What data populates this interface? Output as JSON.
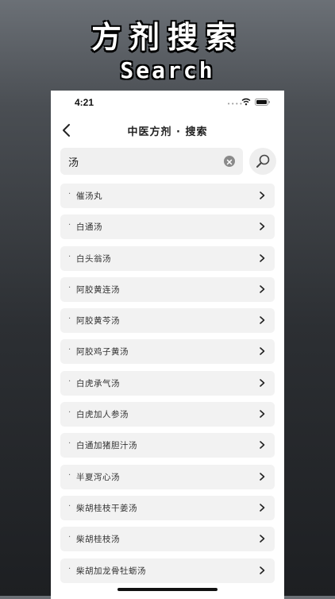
{
  "promo": {
    "title": "方剂搜索",
    "subtitle": "Search"
  },
  "status_bar": {
    "time": "4:21"
  },
  "nav": {
    "title": "中医方剂 · 搜索"
  },
  "search": {
    "value": "汤",
    "placeholder": ""
  },
  "results": [
    {
      "label": "催汤丸"
    },
    {
      "label": "白通汤"
    },
    {
      "label": "白头翁汤"
    },
    {
      "label": "阿胶黄连汤"
    },
    {
      "label": "阿胶黄芩汤"
    },
    {
      "label": "阿胶鸡子黄汤"
    },
    {
      "label": "白虎承气汤"
    },
    {
      "label": "白虎加人参汤"
    },
    {
      "label": "白通加猪胆汁汤"
    },
    {
      "label": "半夏泻心汤"
    },
    {
      "label": "柴胡桂枝干姜汤"
    },
    {
      "label": "柴胡桂枝汤"
    },
    {
      "label": "柴胡加龙骨牡蛎汤"
    }
  ],
  "colors": {
    "accent": "#ffffff",
    "item_bg": "#f2f2f2"
  },
  "icons": {
    "back": "chevron-left-icon",
    "clear": "clear-icon",
    "search": "search-icon",
    "row": "chevron-right-icon"
  }
}
